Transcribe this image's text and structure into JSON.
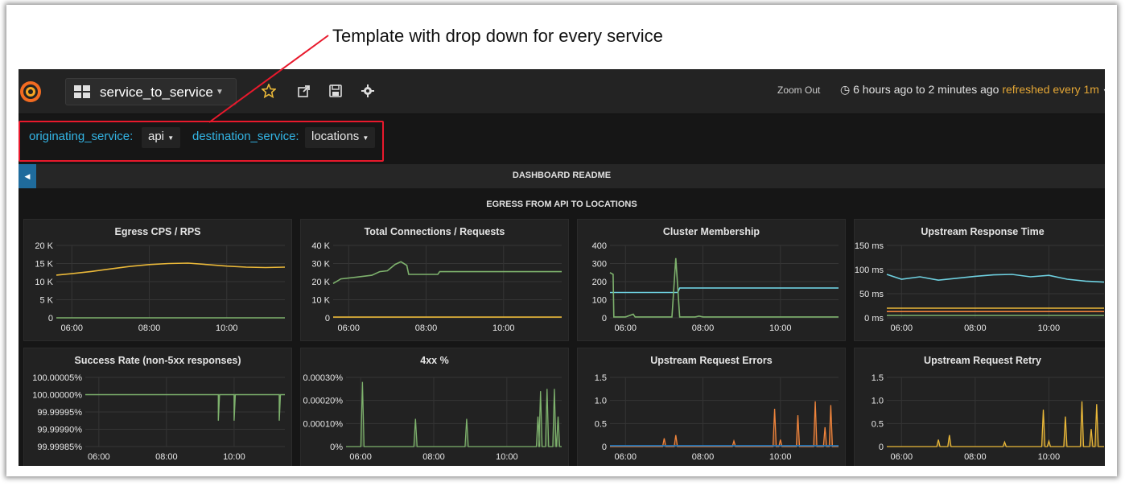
{
  "annotation": {
    "text": "Template with drop down for every service",
    "color": "#e8192c"
  },
  "navbar": {
    "dashboard_name": "service_to_service",
    "icons": [
      "grafana-logo-icon",
      "dashboard-grid-icon",
      "star-icon",
      "share-icon",
      "save-icon",
      "gear-icon"
    ],
    "zoom_out_label": "Zoom Out",
    "time_range": "6 hours ago to 2 minutes ago",
    "refresh_text": "refreshed every 1m",
    "refresh_color": "#e3a635"
  },
  "variables": [
    {
      "label": "originating_service:",
      "value": "api"
    },
    {
      "label": "destination_service:",
      "value": "locations"
    }
  ],
  "rows": {
    "readme_title": "DASHBOARD README",
    "egress_title": "EGRESS FROM API TO LOCATIONS"
  },
  "colors": {
    "green": "#7eb26d",
    "yellow": "#eab839",
    "teal": "#6ed0e0",
    "orange": "#ef843c",
    "blue": "#1f78c1",
    "label_blue": "#33b5e5"
  },
  "panels": [
    {
      "title": "Egress CPS / RPS",
      "chart_data": {
        "type": "line",
        "x_ticks": [
          "06:00",
          "08:00",
          "10:00"
        ],
        "y_ticks": [
          "0",
          "5 K",
          "10 K",
          "15 K",
          "20 K"
        ],
        "ylim": [
          0,
          20000
        ],
        "series": [
          {
            "color": "#eab839",
            "points": [
              [
                5.6,
                11800
              ],
              [
                6,
                12200
              ],
              [
                6.5,
                12800
              ],
              [
                7,
                13500
              ],
              [
                7.5,
                14200
              ],
              [
                8,
                14700
              ],
              [
                8.5,
                15000
              ],
              [
                9,
                15100
              ],
              [
                9.5,
                14700
              ],
              [
                10,
                14300
              ],
              [
                10.5,
                14000
              ],
              [
                11,
                13900
              ],
              [
                11.5,
                14000
              ]
            ]
          },
          {
            "color": "#7eb26d",
            "points": [
              [
                5.6,
                0
              ],
              [
                11.5,
                0
              ]
            ]
          }
        ]
      }
    },
    {
      "title": "Total Connections / Requests",
      "chart_data": {
        "type": "line",
        "x_ticks": [
          "06:00",
          "08:00",
          "10:00"
        ],
        "y_ticks": [
          "0",
          "10 K",
          "20 K",
          "30 K",
          "40 K"
        ],
        "ylim": [
          0,
          40000
        ],
        "series": [
          {
            "color": "#7eb26d",
            "points": [
              [
                5.6,
                19000
              ],
              [
                5.8,
                21500
              ],
              [
                6.2,
                22500
              ],
              [
                6.6,
                23500
              ],
              [
                6.8,
                25500
              ],
              [
                7,
                26000
              ],
              [
                7.2,
                29500
              ],
              [
                7.35,
                31000
              ],
              [
                7.5,
                29000
              ],
              [
                7.55,
                24000
              ],
              [
                8,
                24000
              ],
              [
                8.3,
                24000
              ],
              [
                8.35,
                25500
              ],
              [
                9,
                25500
              ],
              [
                10,
                25500
              ],
              [
                11.5,
                25500
              ]
            ]
          },
          {
            "color": "#eab839",
            "points": [
              [
                5.6,
                400
              ],
              [
                11.5,
                400
              ]
            ]
          }
        ]
      }
    },
    {
      "title": "Cluster Membership",
      "chart_data": {
        "type": "line",
        "x_ticks": [
          "06:00",
          "08:00",
          "10:00"
        ],
        "y_ticks": [
          "0",
          "100",
          "200",
          "300",
          "400"
        ],
        "ylim": [
          0,
          400
        ],
        "series": [
          {
            "color": "#6ed0e0",
            "points": [
              [
                5.6,
                140
              ],
              [
                7.35,
                140
              ],
              [
                7.4,
                165
              ],
              [
                11.5,
                165
              ]
            ]
          },
          {
            "color": "#7eb26d",
            "points": [
              [
                5.6,
                250
              ],
              [
                5.68,
                240
              ],
              [
                5.7,
                5
              ],
              [
                6,
                5
              ],
              [
                6.2,
                20
              ],
              [
                6.25,
                5
              ],
              [
                7.2,
                5
              ],
              [
                7.3,
                330
              ],
              [
                7.4,
                5
              ],
              [
                7.8,
                5
              ],
              [
                7.9,
                10
              ],
              [
                8,
                5
              ],
              [
                11.5,
                5
              ]
            ]
          }
        ]
      }
    },
    {
      "title": "Upstream Response Time",
      "chart_data": {
        "type": "line",
        "x_ticks": [
          "06:00",
          "08:00",
          "10:00"
        ],
        "y_ticks": [
          "0 ms",
          "50 ms",
          "100 ms",
          "150 ms"
        ],
        "ylim": [
          0,
          150
        ],
        "series": [
          {
            "color": "#6ed0e0",
            "points": [
              [
                5.6,
                90
              ],
              [
                6,
                80
              ],
              [
                6.5,
                85
              ],
              [
                7,
                78
              ],
              [
                7.5,
                82
              ],
              [
                8,
                86
              ],
              [
                8.5,
                89
              ],
              [
                9,
                90
              ],
              [
                9.5,
                85
              ],
              [
                10,
                88
              ],
              [
                10.5,
                80
              ],
              [
                11,
                76
              ],
              [
                11.5,
                74
              ]
            ]
          },
          {
            "color": "#eab839",
            "points": [
              [
                5.6,
                20
              ],
              [
                11.5,
                20
              ]
            ]
          },
          {
            "color": "#ef843c",
            "points": [
              [
                5.6,
                13
              ],
              [
                11.5,
                13
              ]
            ]
          },
          {
            "color": "#7eb26d",
            "points": [
              [
                5.6,
                5
              ],
              [
                11.5,
                5
              ]
            ]
          }
        ]
      }
    },
    {
      "title": "Success Rate (non-5xx responses)",
      "chart_data": {
        "type": "line",
        "x_ticks": [
          "06:00",
          "08:00",
          "10:00"
        ],
        "y_ticks": [
          "99.99985%",
          "99.99990%",
          "99.99995%",
          "100.00000%",
          "100.00005%"
        ],
        "series": [
          {
            "color": "#7eb26d",
            "drops_at": [
              "09:32",
              "10:00",
              "11:20"
            ]
          }
        ]
      }
    },
    {
      "title": "4xx %",
      "chart_data": {
        "type": "line",
        "x_ticks": [
          "06:00",
          "08:00",
          "10:00"
        ],
        "y_ticks": [
          "0%",
          "0.00010%",
          "0.00020%",
          "0.00030%"
        ],
        "ylim": [
          0,
          0.0003
        ],
        "series": [
          {
            "color": "#7eb26d",
            "spikes": [
              [
                6.05,
                0.00028
              ],
              [
                7.5,
                0.00012
              ],
              [
                8.9,
                0.00012
              ],
              [
                10.85,
                0.00013
              ],
              [
                10.92,
                0.00024
              ],
              [
                11.1,
                0.00025
              ],
              [
                11.3,
                0.00025
              ],
              [
                11.4,
                0.00013
              ]
            ]
          }
        ]
      }
    },
    {
      "title": "Upstream Request Errors",
      "chart_data": {
        "type": "line",
        "x_ticks": [
          "06:00",
          "08:00",
          "10:00"
        ],
        "y_ticks": [
          "0",
          "0.5",
          "1.0",
          "1.5"
        ],
        "ylim": [
          0,
          1.5
        ],
        "series": [
          {
            "color": "#ef843c",
            "spikes": [
              [
                7.0,
                0.18
              ],
              [
                7.3,
                0.25
              ],
              [
                8.8,
                0.12
              ],
              [
                9.85,
                0.82
              ],
              [
                10.0,
                0.15
              ],
              [
                10.45,
                0.68
              ],
              [
                10.9,
                0.98
              ],
              [
                11.15,
                0.42
              ],
              [
                11.3,
                0.9
              ]
            ]
          },
          {
            "color": "#1f78c1",
            "points": [
              [
                5.6,
                0.02
              ],
              [
                11.5,
                0.02
              ]
            ]
          }
        ]
      }
    },
    {
      "title": "Upstream Request Retry",
      "chart_data": {
        "type": "line",
        "x_ticks": [
          "06:00",
          "08:00",
          "10:00"
        ],
        "y_ticks": [
          "0",
          "0.5",
          "1.0",
          "1.5"
        ],
        "ylim": [
          0,
          1.5
        ],
        "series": [
          {
            "color": "#eab839",
            "spikes": [
              [
                7.0,
                0.15
              ],
              [
                7.3,
                0.25
              ],
              [
                8.8,
                0.1
              ],
              [
                9.85,
                0.8
              ],
              [
                10.0,
                0.12
              ],
              [
                10.45,
                0.65
              ],
              [
                10.9,
                0.98
              ],
              [
                11.15,
                0.38
              ],
              [
                11.3,
                0.92
              ]
            ]
          }
        ]
      }
    }
  ]
}
